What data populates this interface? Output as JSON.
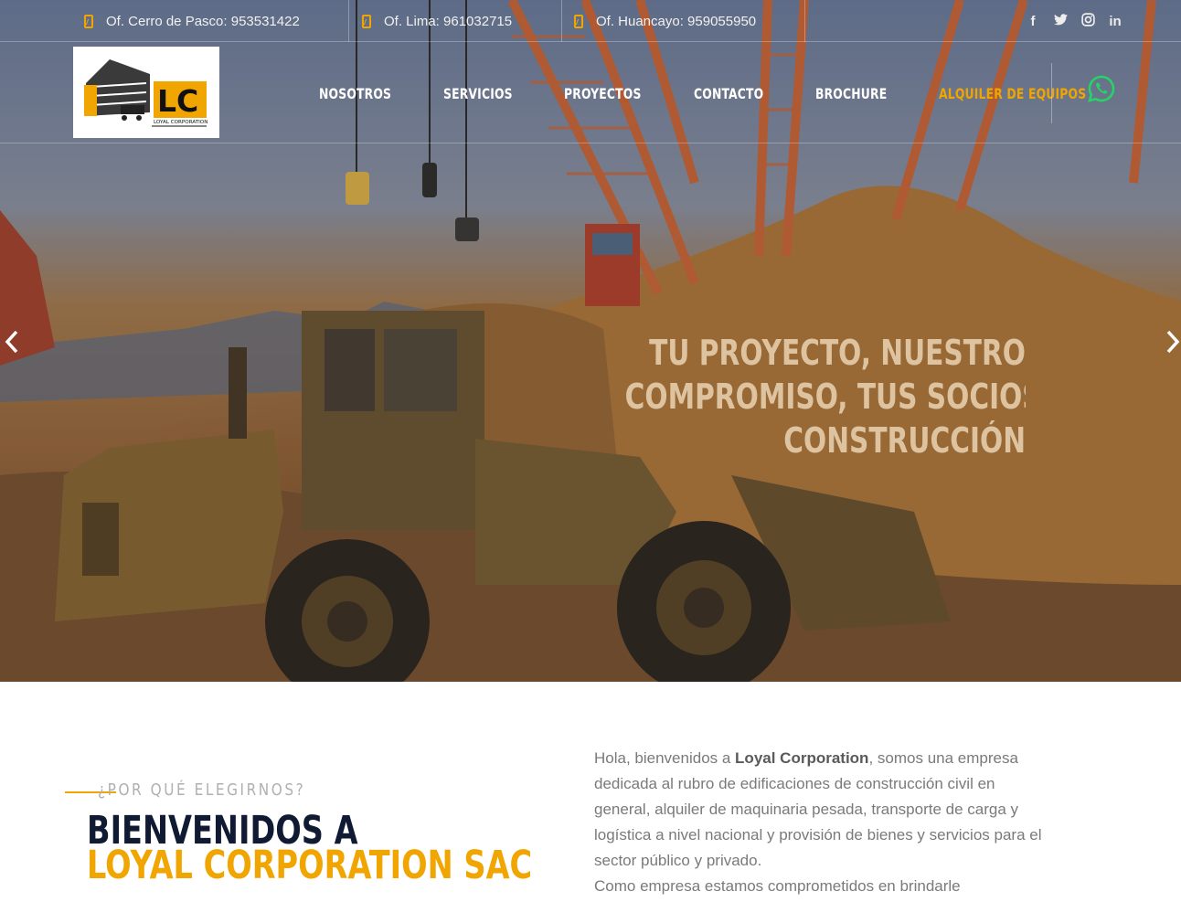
{
  "topbar": {
    "contacts": [
      {
        "label": "Of. Cerro de Pasco: 953531422"
      },
      {
        "label": "Of. Lima: 961032715"
      },
      {
        "label": "Of. Huancayo: 959055950"
      }
    ],
    "socials": [
      {
        "name": "facebook-icon",
        "glyph": "f"
      },
      {
        "name": "twitter-icon",
        "glyph": "t"
      },
      {
        "name": "instagram-icon",
        "glyph": "◎"
      },
      {
        "name": "linkedin-icon",
        "glyph": "in"
      }
    ]
  },
  "brand": {
    "logo_text": "LC",
    "logo_subtext": "LOYAL CORPORATION"
  },
  "nav": {
    "items": [
      {
        "label": "NOSOTROS"
      },
      {
        "label": "SERVICIOS"
      },
      {
        "label": "PROYECTOS"
      },
      {
        "label": "CONTACTO"
      },
      {
        "label": "BROCHURE"
      },
      {
        "label": "ALQUILER DE EQUIPOS"
      }
    ]
  },
  "hero": {
    "lines": [
      "TU PROYECTO, NUESTRO",
      "COMPROMISO, TUS SOCIOS EN LA",
      "CONSTRUCCIÓN"
    ],
    "prev": "‹",
    "next": "›"
  },
  "about": {
    "kicker": "¿POR QUÉ ELEGIRNOS?",
    "title_line1": "BIENVENIDOS A",
    "title_line2": "LOYAL CORPORATION SAC",
    "intro_pre": "Hola, bienvenidos a ",
    "intro_brand": "Loyal Corporation",
    "intro_post": ", somos una empresa dedicada al rubro de edificaciones de construcción civil en general, alquiler de maquinaria pesada, transporte de carga y logística a nivel nacional y provisión de bienes y servicios para el sector público y privado.",
    "intro_second": "Como empresa estamos comprometidos en brindarle"
  },
  "colors": {
    "accent": "#f0a500",
    "navy": "#101a33",
    "whatsapp": "#25d366"
  }
}
